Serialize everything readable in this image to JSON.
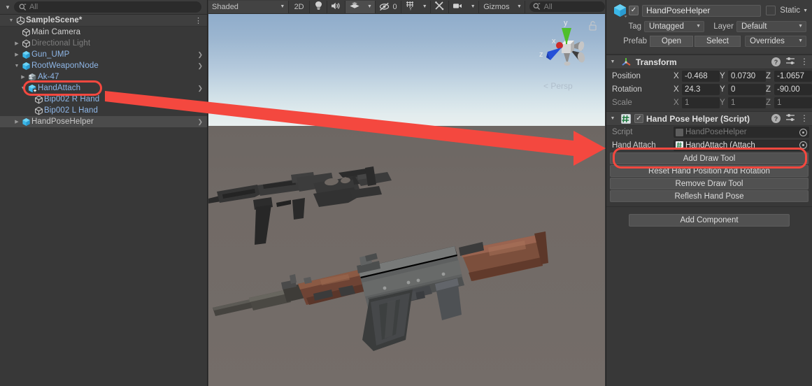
{
  "hierarchy": {
    "search": {
      "placeholder": "All",
      "icon": "search-icon"
    },
    "scene_name": "SampleScene*",
    "items": [
      {
        "label": "Main Camera",
        "indent": 2,
        "arrow": "none",
        "icon": "gameobject-icon",
        "style": "plain",
        "chevron": false,
        "selected": false
      },
      {
        "label": "Directional Light",
        "indent": 2,
        "arrow": "collapsed",
        "icon": "gameobject-icon",
        "style": "dim",
        "chevron": false,
        "selected": false
      },
      {
        "label": "Gun_UMP",
        "indent": 2,
        "arrow": "collapsed",
        "icon": "prefab-icon",
        "style": "prefab",
        "chevron": true,
        "selected": false
      },
      {
        "label": "RootWeaponNode",
        "indent": 2,
        "arrow": "expanded",
        "icon": "prefab-icon",
        "style": "prefab",
        "chevron": true,
        "selected": false
      },
      {
        "label": "Ak-47",
        "indent": 3,
        "arrow": "collapsed",
        "icon": "prefab-model-icon",
        "style": "prefab",
        "chevron": false,
        "selected": false
      },
      {
        "label": "HandAttach",
        "indent": 3,
        "arrow": "expanded",
        "icon": "prefab-plus-icon",
        "style": "prefab",
        "chevron": true,
        "selected": false
      },
      {
        "label": "Bip002 R Hand",
        "indent": 4,
        "arrow": "none",
        "icon": "gameobject-icon",
        "style": "prefab",
        "chevron": false,
        "selected": false
      },
      {
        "label": "Bip002 L Hand",
        "indent": 4,
        "arrow": "none",
        "icon": "gameobject-icon",
        "style": "prefab",
        "chevron": false,
        "selected": false
      },
      {
        "label": "HandPoseHelper",
        "indent": 2,
        "arrow": "collapsed",
        "icon": "prefab-icon",
        "style": "sel",
        "chevron": true,
        "selected": true
      }
    ]
  },
  "scene_toolbar": {
    "shading_mode": "Shaded",
    "view_2d": "2D",
    "lighting_icon": "lightbulb-icon",
    "audio_icon": "speaker-icon",
    "fx_icon": "effects-icon",
    "fx_caret": "chevron-down-icon",
    "hidden_icon": "eye-slash-icon",
    "hidden_count": "0",
    "grid_icon": "grid-icon",
    "grid_caret": "chevron-down-icon",
    "tools_icon": "tools-icon",
    "camera_icon": "camera-icon",
    "camera_caret": "chevron-down-icon",
    "gizmos_label": "Gizmos",
    "gizmos_caret": "chevron-down-icon",
    "search_placeholder": "All",
    "search_icon": "search-icon"
  },
  "scene_view": {
    "perspective_label": "Persp",
    "gizmo_axes": {
      "x": "x",
      "y": "y",
      "z": "z"
    },
    "lock_icon": "unlocked-padlock-icon",
    "sky_top_color": "#8faccb",
    "sky_horizon_color": "#e9efef",
    "ground_color": "#716a66"
  },
  "inspector": {
    "object_icon": "prefab-cube-icon",
    "enabled_checked": true,
    "check_glyph": "✓",
    "name": "HandPoseHelper",
    "static_label": "Static",
    "static_caret": "chevron-down-icon",
    "tag_label": "Tag",
    "tag_value": "Untagged",
    "layer_label": "Layer",
    "layer_value": "Default",
    "prefab_label": "Prefab",
    "prefab_open": "Open",
    "prefab_select": "Select",
    "prefab_overrides": "Overrides",
    "transform": {
      "title": "Transform",
      "icon": "transform-axes-icon",
      "help_icon": "help-icon",
      "preset_icon": "preset-sliders-icon",
      "menu_icon": "kebab-menu-icon",
      "rows": [
        {
          "label": "Position",
          "dim": false,
          "x": "-0.468",
          "y": "0.0730",
          "z": "-1.0657"
        },
        {
          "label": "Rotation",
          "dim": false,
          "x": "24.3",
          "y": "0",
          "z": "-90.00"
        },
        {
          "label": "Scale",
          "dim": true,
          "x": "1",
          "y": "1",
          "z": "1"
        }
      ]
    },
    "script_component": {
      "title": "Hand Pose Helper (Script)",
      "icon": "cs-script-icon",
      "enabled_checked": true,
      "help_icon": "help-icon",
      "preset_icon": "preset-sliders-icon",
      "menu_icon": "kebab-menu-icon",
      "script_row": {
        "label": "Script",
        "value": "HandPoseHelper"
      },
      "hand_attach_row": {
        "label": "Hand Attach",
        "value": "HandAttach (Attach"
      },
      "buttons": [
        "Add Draw Tool",
        "Reset Hand Position And Rotation",
        "Remove Draw Tool",
        "Reflesh Hand Pose"
      ]
    },
    "add_component": "Add Component"
  },
  "annotation": {
    "highlight_color": "#f4483f",
    "arrow_icon": "red-arrow-pointing-right",
    "boxes": [
      {
        "name": "hierarchy-handattach-highlight"
      },
      {
        "name": "inspector-handattach-field-highlight"
      }
    ]
  }
}
